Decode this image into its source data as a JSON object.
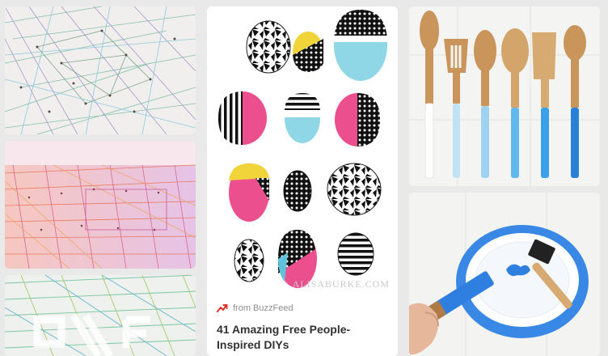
{
  "colors": {
    "background": "#e9e9e9",
    "card": "#ffffff",
    "title_text": "#333333",
    "source_text": "#8e8e8e",
    "trending_red": "#e0322a"
  },
  "pins": [
    {
      "id": "string-art-1",
      "image_icon": "string-art-photo"
    },
    {
      "id": "string-art-2",
      "image_icon": "string-art-photo"
    },
    {
      "id": "string-art-3",
      "image_icon": "string-art-photo"
    },
    {
      "id": "painted-rocks",
      "image_icon": "painted-rocks-photo",
      "watermark": "ALISABURKE.COM",
      "source_icon": "trending-arrow-icon",
      "source_label": "from BuzzFeed",
      "title": "41 Amazing Free People-Inspired DIYs"
    },
    {
      "id": "painted-spoons",
      "image_icon": "painted-utensils-photo"
    },
    {
      "id": "painting-plate",
      "image_icon": "painting-plate-photo"
    }
  ]
}
